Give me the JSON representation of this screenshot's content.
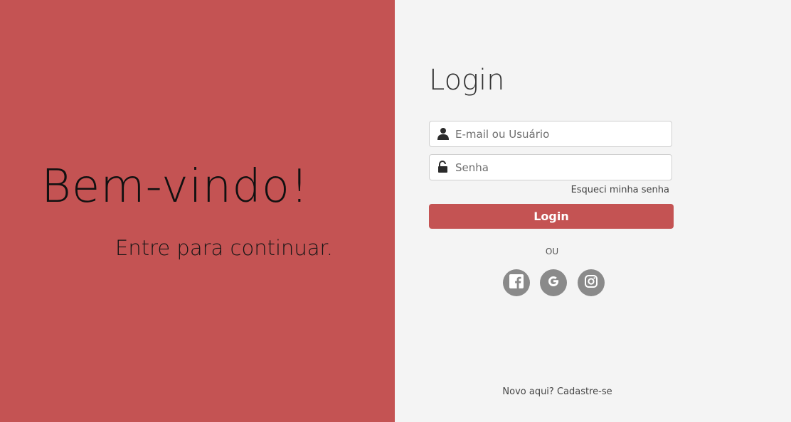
{
  "welcome": {
    "title": "Bem-vindo!",
    "subtitle": "Entre para continuar."
  },
  "login": {
    "title": "Login",
    "email_placeholder": "E-mail ou Usuário",
    "password_placeholder": "Senha",
    "forgot_label": "Esqueci minha senha",
    "button_label": "Login",
    "or_label": "OU",
    "signup_label": "Novo aqui? Cadastre-se"
  },
  "social": [
    {
      "name": "facebook",
      "icon": "facebook-icon"
    },
    {
      "name": "google",
      "icon": "google-icon"
    },
    {
      "name": "instagram",
      "icon": "instagram-icon"
    }
  ],
  "colors": {
    "brand": "#c45353",
    "background": "#f4f4f4",
    "social_bg": "#8a8a8a"
  }
}
